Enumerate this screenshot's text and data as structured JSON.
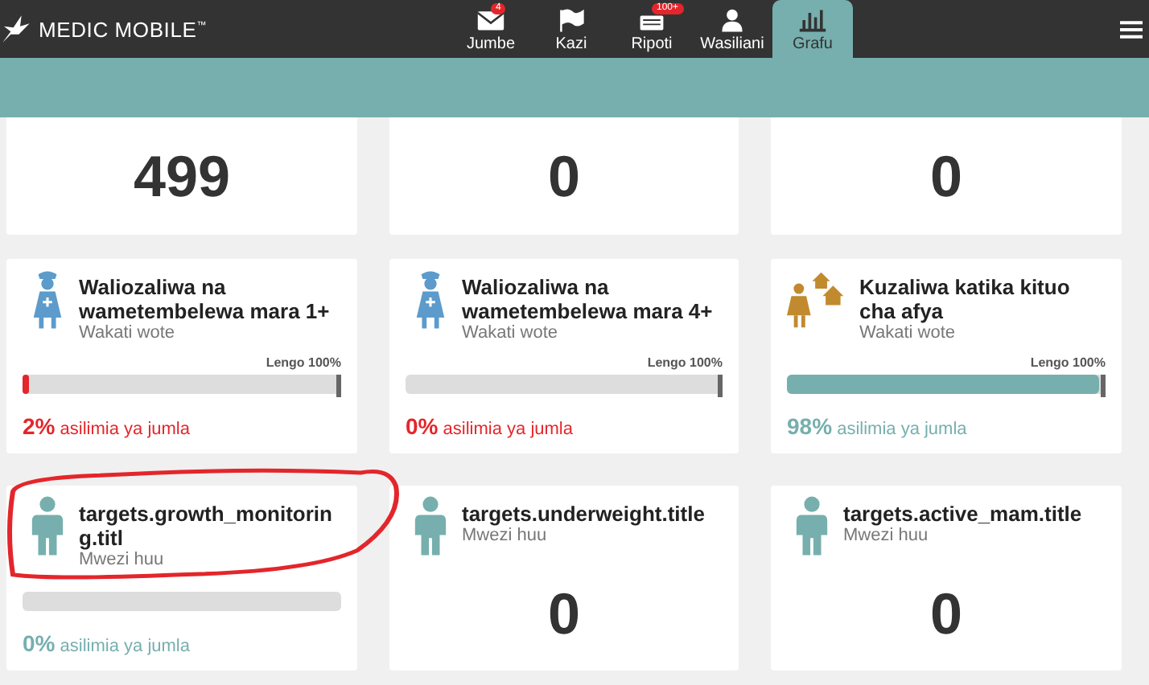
{
  "brand": {
    "name": "MEDIC MOBILE",
    "mark": "™"
  },
  "tabs": [
    {
      "label": "Jumbe",
      "badge": "4",
      "selected": false
    },
    {
      "label": "Kazi",
      "selected": false
    },
    {
      "label": "Ripoti",
      "badge": "100+",
      "selected": false
    },
    {
      "label": "Wasiliani",
      "selected": false
    },
    {
      "label": "Grafu",
      "selected": true
    }
  ],
  "cards": [
    {
      "kind": "count",
      "value": "499"
    },
    {
      "kind": "count",
      "value": "0"
    },
    {
      "kind": "count",
      "value": "0"
    },
    {
      "kind": "progress",
      "title": "Waliozaliwa na wametembelewa mara 1+",
      "subtitle": "Wakati wote",
      "goal": "Lengo 100%",
      "level": 0.02,
      "percent": "2%",
      "percent_label": "asilimia ya jumla",
      "color": "#e3262b"
    },
    {
      "kind": "progress",
      "title": "Waliozaliwa na wametembelewa mara 4+",
      "subtitle": "Wakati wote",
      "goal": "Lengo 100%",
      "level": 0,
      "percent": "0%",
      "percent_label": "asilimia ya jumla",
      "color": "#e3262b"
    },
    {
      "kind": "progress",
      "title": "Kuzaliwa katika kituo cha afya",
      "subtitle": "Wakati wote",
      "goal": "Lengo 100%",
      "level": 0.98,
      "percent": "98%",
      "percent_label": "asilimia ya jumla",
      "color": "#76afae"
    },
    {
      "kind": "progress",
      "title": "targets.growth_monitoring.titl",
      "subtitle": "Mwezi huu",
      "level": 0,
      "percent": "0%",
      "percent_label": "asilimia ya jumla",
      "color": "#76afae"
    },
    {
      "kind": "count",
      "title": "targets.underweight.title",
      "subtitle": "Mwezi huu",
      "value": "0"
    },
    {
      "kind": "count",
      "title": "targets.active_mam.title",
      "subtitle": "Mwezi huu",
      "value": "0"
    }
  ]
}
